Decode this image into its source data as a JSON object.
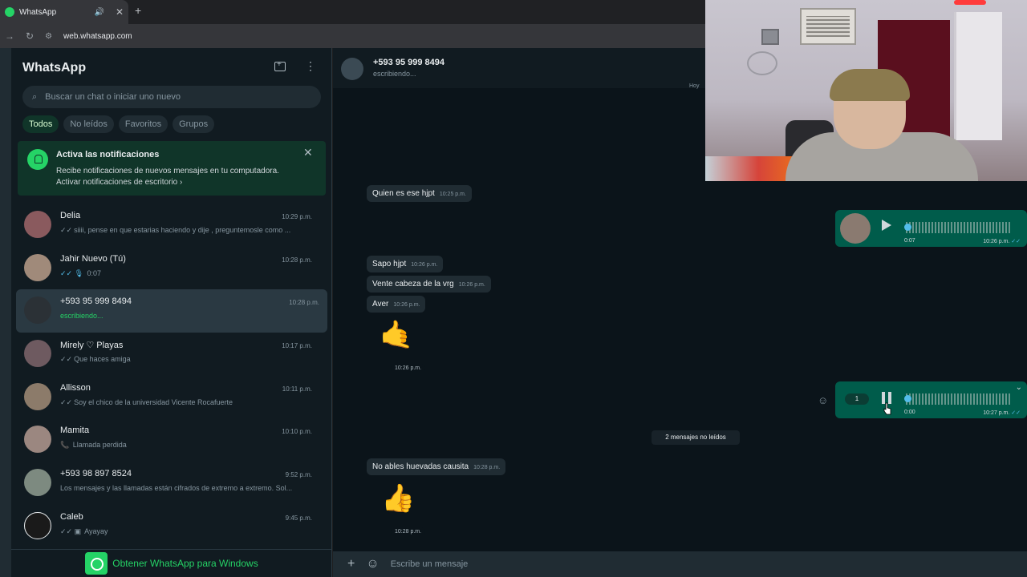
{
  "browser": {
    "tab_title": "WhatsApp",
    "url": "web.whatsapp.com"
  },
  "sidebar": {
    "title": "WhatsApp",
    "search_placeholder": "Buscar un chat o iniciar uno nuevo",
    "filters": [
      "Todos",
      "No leídos",
      "Favoritos",
      "Grupos"
    ],
    "notification": {
      "title": "Activa las notificaciones",
      "body": "Recibe notificaciones de nuevos mensajes en tu computadora.",
      "link": "Activar notificaciones de escritorio"
    },
    "chats": [
      {
        "name": "Delia",
        "time": "10:29 p.m.",
        "preview": "siiii, pense en que estarias haciendo y dije , preguntemosle como ...",
        "tick": "✓✓",
        "tick_color": "grey"
      },
      {
        "name": "Jahir Nuevo (Tú)",
        "time": "10:28 p.m.",
        "preview": "0:07",
        "tick": "✓✓ 🎙",
        "tick_color": "blue"
      },
      {
        "name": "+593 95 999 8494",
        "time": "10:28 p.m.",
        "preview": "escribiendo...",
        "tick": "",
        "tick_color": "none"
      },
      {
        "name": "Mirely ♡ Playas",
        "time": "10:17 p.m.",
        "preview": "Que haces amiga",
        "tick": "✓✓",
        "tick_color": "grey"
      },
      {
        "name": "Allisson",
        "time": "10:11 p.m.",
        "preview": "Soy el chico de la universidad Vicente Rocafuerte",
        "tick": "✓✓",
        "tick_color": "grey"
      },
      {
        "name": "Mamita",
        "time": "10:10 p.m.",
        "preview": "Llamada perdida",
        "tick": "📞",
        "tick_color": "red"
      },
      {
        "name": "+593 98 897 8524",
        "time": "9:52 p.m.",
        "preview": "Los mensajes y las llamadas están cifrados de extremo a extremo. Sol...",
        "tick": "",
        "tick_color": "none"
      },
      {
        "name": "Caleb",
        "time": "9:45 p.m.",
        "preview": "Ayayay",
        "tick": "✓✓ ▣",
        "tick_color": "grey"
      }
    ],
    "get_windows": "Obtener WhatsApp para Windows"
  },
  "conversation": {
    "contact_name": "+593 95 999 8494",
    "status": "escribiendo...",
    "date_label": "Hoy",
    "messages": [
      {
        "text": "Quien es ese hjpt",
        "time": "10:25 p.m."
      },
      {
        "text": "Sapo hjpt",
        "time": "10:26 p.m."
      },
      {
        "text": "Vente cabeza de la vrg",
        "time": "10:26 p.m."
      },
      {
        "text": "Aver",
        "time": "10:26 p.m."
      },
      {
        "text": "No ables huevadas causita",
        "time": "10:28 p.m."
      }
    ],
    "stickers": [
      {
        "emoji": "🤙",
        "time": "10:26 p.m."
      },
      {
        "emoji": "👍",
        "time": "10:28 p.m."
      }
    ],
    "voice_notes": [
      {
        "duration": "0:07",
        "time": "10:26 p.m.",
        "state": "paused"
      },
      {
        "duration": "0:00",
        "time": "10:27 p.m.",
        "state": "playing",
        "speed": "1"
      }
    ],
    "unread_divider": "2 mensajes no leídos",
    "composer_placeholder": "Escribe un mensaje"
  },
  "colors": {
    "accent": "#25d366",
    "outgoing_bubble": "#005c4b",
    "incoming_bubble": "#202c33",
    "background": "#0b141a"
  }
}
